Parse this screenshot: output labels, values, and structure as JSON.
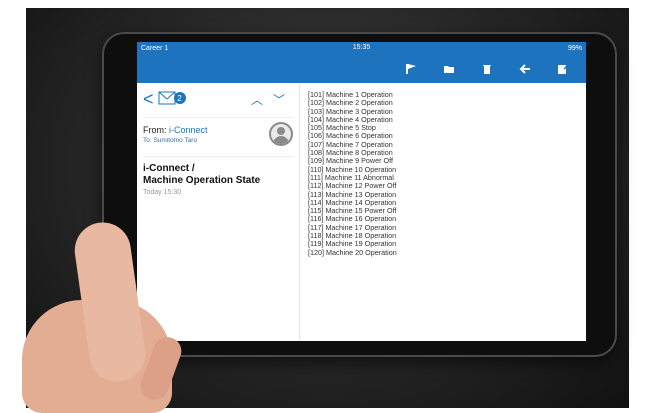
{
  "status": {
    "carrier": "Career 1",
    "time": "15:35",
    "battery": "99%"
  },
  "toolbar": {
    "icons": [
      "flag-icon",
      "folder-icon",
      "trash-icon",
      "arrow-left-icon",
      "compose-icon"
    ]
  },
  "mail": {
    "back": "<",
    "unread_count": "2",
    "from_label": "From:",
    "from_name": "i-Connect",
    "to": "To: Sumitomo Taro",
    "subject": "i-Connect  /\nMachine Operation State",
    "subject_line1": "i-Connect  /",
    "subject_line2": "Machine Operation State",
    "time": "Today 15:30"
  },
  "body_lines": [
    "[101] Machine 1 Operation",
    "[102] Machine 2 Operation",
    "[103] Machine 3 Operation",
    "[104] Machine 4 Operation",
    "[105] Machine 5 Stop",
    "[106] Machine 6 Operation",
    "[107] Machine 7 Operation",
    "[108] Machine 8 Operation",
    "[109] Machine 9 Power Off",
    "[110] Machine 10 Operation",
    "[111] Machine 11 Abnormal",
    "[112] Machine 12 Power Off",
    "[113] Machine 13 Operation",
    "[114] Machine 14 Operation",
    "[115] Machine 15 Power Off",
    "[116] Machine 16 Operation",
    "[117] Machine 17 Operation",
    "[118] Machine 18 Operation",
    "[119] Machine 19 Operation",
    "[120] Machine 20 Operation"
  ],
  "colors": {
    "accent": "#1e73be",
    "background": "#2a2a2a"
  }
}
